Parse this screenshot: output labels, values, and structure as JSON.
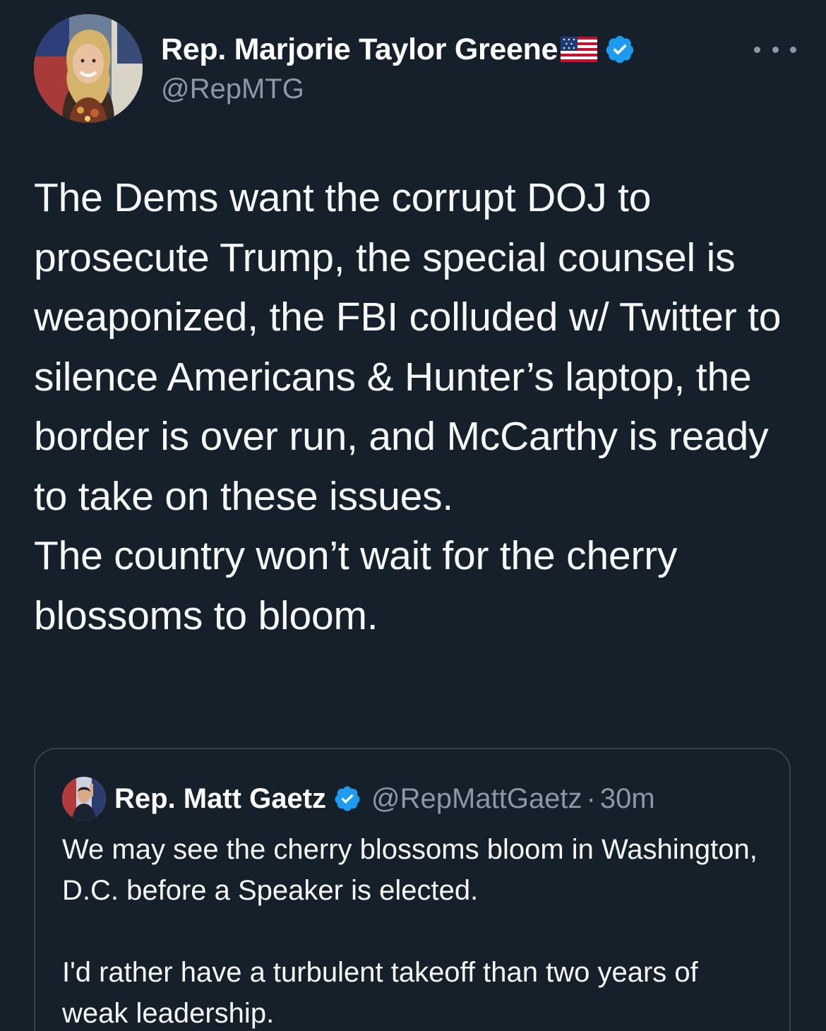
{
  "author": {
    "display_name": "Rep. Marjorie Taylor Greene",
    "handle": "@RepMTG"
  },
  "icons": {
    "flag": "us-flag-emoji",
    "verified": "verified-badge-icon",
    "more": "more-options-icon"
  },
  "tweet": {
    "paragraph_1": "The Dems want the corrupt DOJ to prosecute Trump, the special counsel is weaponized, the FBI colluded w/ Twitter to silence Americans & Hunter’s laptop, the border is over run, and McCarthy is ready to take on these issues.",
    "paragraph_2": "The country won’t wait for the cherry blossoms to bloom."
  },
  "quoted_tweet": {
    "display_name": "Rep. Matt Gaetz",
    "handle": "@RepMattGaetz",
    "separator": "·",
    "time": "30m",
    "paragraph_1": "We may see the cherry blossoms bloom in Washington, D.C. before a Speaker is elected.",
    "paragraph_2": "I'd rather have a turbulent takeoff than two years of weak leadership."
  },
  "colors": {
    "background": "#15202b",
    "text": "#f7f9f9",
    "secondary_text": "#8b98a5",
    "verified_blue": "#1d9bf0",
    "border": "#38444d"
  }
}
